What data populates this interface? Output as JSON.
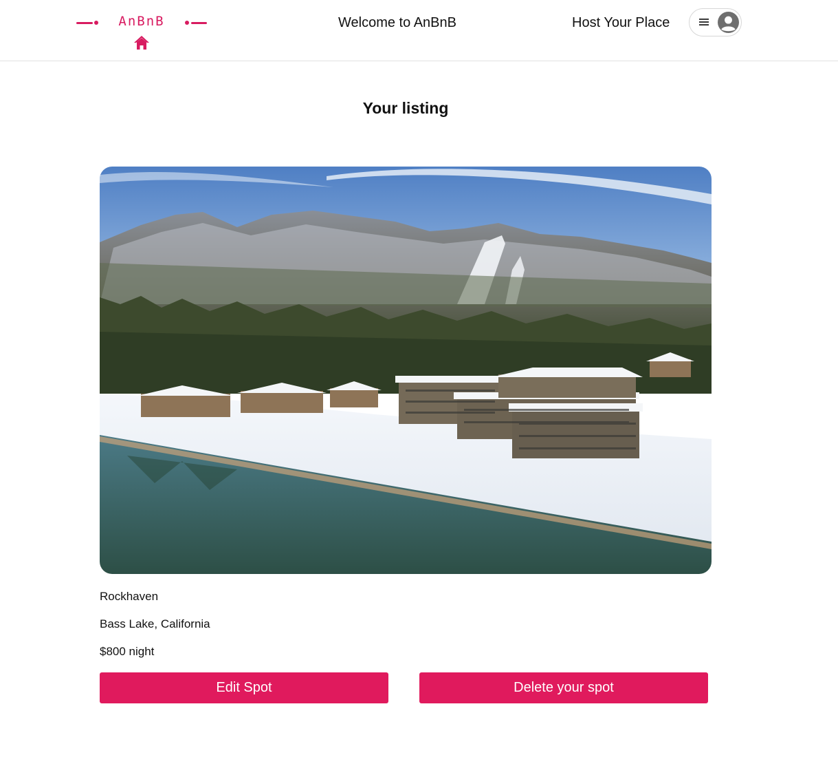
{
  "header": {
    "logo_text": "AnBnB",
    "welcome_text": "Welcome to AnBnB",
    "host_link": "Host Your Place",
    "icons": {
      "logo": "house-icon",
      "menu": "hamburger-menu-icon",
      "profile": "user-avatar-icon"
    }
  },
  "main": {
    "title": "Your listing",
    "listing": {
      "image_alt": "snowy-lakeside-resort-photo",
      "name": "Rockhaven",
      "location": "Bass Lake, California",
      "price": "$800 night"
    },
    "actions": {
      "edit_label": "Edit Spot",
      "delete_label": "Delete your spot"
    }
  },
  "colors": {
    "brand": "#d81b60",
    "button": "#e01a5d",
    "border": "#e2e2e2"
  }
}
